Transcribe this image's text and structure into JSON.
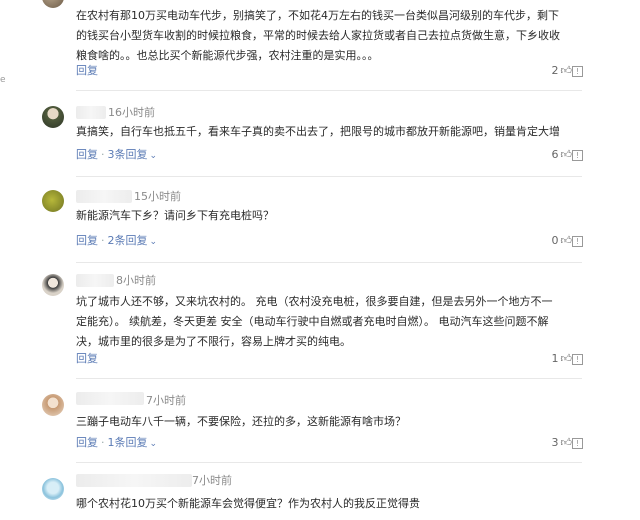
{
  "page": {
    "edge_mark": "e"
  },
  "comments": [
    {
      "time": "",
      "body": "在农村有那10万买电动车代步，别搞笑了，不如花4万左右的钱买一台类似昌河级别的车代步，剩下\n的钱买台小型货车收割的时候拉粮食，平常的时候去给人家拉货或者自己去拉点货做生意，下乡收收\n粮食啥的。。也总比买个新能源代步强，农村注重的是实用。。。",
      "reply_label": "回复",
      "replies_label": "",
      "likes": "2"
    },
    {
      "time": "16小时前",
      "body": "真搞笑，自行车也抵五千，看来车子真的卖不出去了，把限号的城市都放开新能源吧，销量肯定大增",
      "reply_label": "回复",
      "replies_label": "3条回复",
      "likes": "6"
    },
    {
      "time": "15小时前",
      "body": "新能源汽车下乡？请问乡下有充电桩吗？",
      "reply_label": "回复",
      "replies_label": "2条回复",
      "likes": "0"
    },
    {
      "time": "8小时前",
      "body": "坑了城市人还不够，又来坑农村的。 充电（农村没充电桩，很多要自建，但是去另外一个地方不一\n定能充）。 续航差，冬天更差 安全（电动车行驶中自燃或者充电时自燃）。 电动汽车这些问题不解\n决，城市里的很多是为了不限行，容易上牌才买的纯电。",
      "reply_label": "回复",
      "replies_label": "",
      "likes": "1"
    },
    {
      "time": "7小时前",
      "body": "三蹦子电动车八千一辆，不要保险，还拉的多，这新能源有啥市场？",
      "reply_label": "回复",
      "replies_label": "1条回复",
      "likes": "3"
    },
    {
      "time": "7小时前",
      "body": "哪个农村花10万买个新能源车会觉得便宜？作为农村人的我反正觉得贵",
      "reply_label": "",
      "replies_label": "",
      "likes": ""
    }
  ],
  "icons": {
    "like": "thumbs-up-icon",
    "report": "report-icon",
    "chevron": "chevron-down-icon"
  },
  "colors": {
    "link": "#5b7bb5",
    "text": "#2a2a2a",
    "meta": "#8a8a8a",
    "divider": "#e8e8e8"
  }
}
